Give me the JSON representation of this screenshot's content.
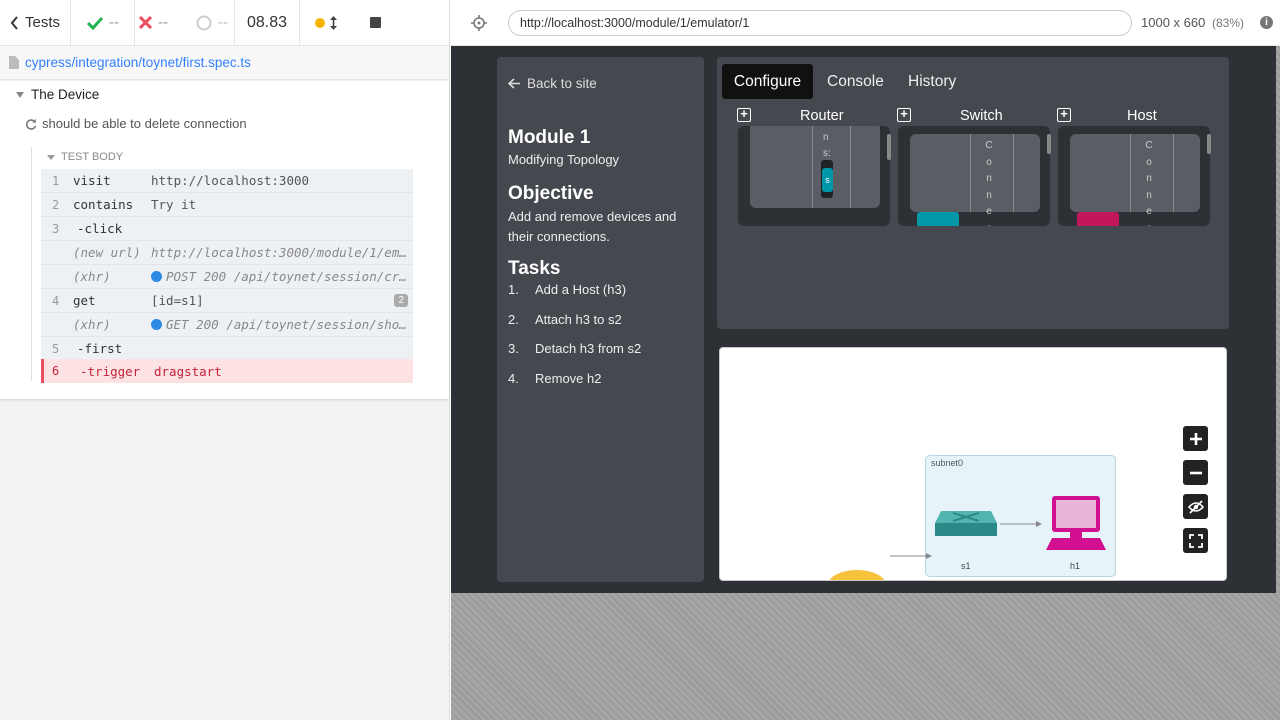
{
  "runner": {
    "back_label": "Tests",
    "passed": "--",
    "failed": "--",
    "pending": "--",
    "duration": "08.83",
    "spec_file": "cypress/integration/toynet/first.spec.ts",
    "suite_title": "The Device",
    "test_title": "should be able to delete connection",
    "section_title": "TEST BODY",
    "commands": [
      {
        "num": "1",
        "name": "visit",
        "msg": "http://localhost:3000"
      },
      {
        "num": "2",
        "name": "contains",
        "msg": "Try it"
      },
      {
        "num": "3",
        "name": "-click",
        "msg": ""
      },
      {
        "num": "",
        "name": "(new url)",
        "msg": "http://localhost:3000/module/1/emu…"
      },
      {
        "num": "",
        "name": "(xhr)",
        "msg": "POST 200 /api/toynet/session/cre…"
      },
      {
        "num": "4",
        "name": "get",
        "msg": "[id=s1]",
        "badge": "2"
      },
      {
        "num": "",
        "name": "(xhr)",
        "msg": "GET 200 /api/toynet/session/show…"
      },
      {
        "num": "5",
        "name": "-first",
        "msg": ""
      },
      {
        "num": "6",
        "name": "-trigger",
        "msg": "dragstart"
      }
    ]
  },
  "browser": {
    "url": "http://localhost:3000/module/1/emulator/1",
    "viewport": "1000 x 660",
    "scale": "(83%)"
  },
  "app": {
    "back_link": "Back to site",
    "module_title": "Module 1",
    "module_subtitle": "Modifying Topology",
    "objective_title": "Objective",
    "objective_text": "Add and remove devices and their connections.",
    "tasks_title": "Tasks",
    "tasks": [
      {
        "n": "1.",
        "text": "Add a Host (h3)"
      },
      {
        "n": "2.",
        "text": "Attach h3 to s2"
      },
      {
        "n": "3.",
        "text": "Detach h3 from s2"
      },
      {
        "n": "4.",
        "text": "Remove h2"
      }
    ],
    "tabs": [
      "Configure",
      "Console",
      "History"
    ],
    "device_types": [
      "Router",
      "Switch",
      "Host"
    ],
    "router_card": {
      "letters": [
        "n",
        "s:"
      ],
      "chip": "s"
    },
    "switch_card": {
      "letters": [
        "C",
        "o",
        "n",
        "n",
        "e",
        "c"
      ]
    },
    "host_card": {
      "letters": [
        "C",
        "o",
        "n",
        "n",
        "e",
        "c"
      ]
    },
    "subnet_label": "subnet0",
    "node_switch_label": "s1",
    "node_host_label": "h1",
    "colors": {
      "router": "#c9b800",
      "switch": "#0097a7",
      "host": "#c2185b",
      "accent": "#3380ff",
      "fail": "#e94f5f"
    }
  }
}
